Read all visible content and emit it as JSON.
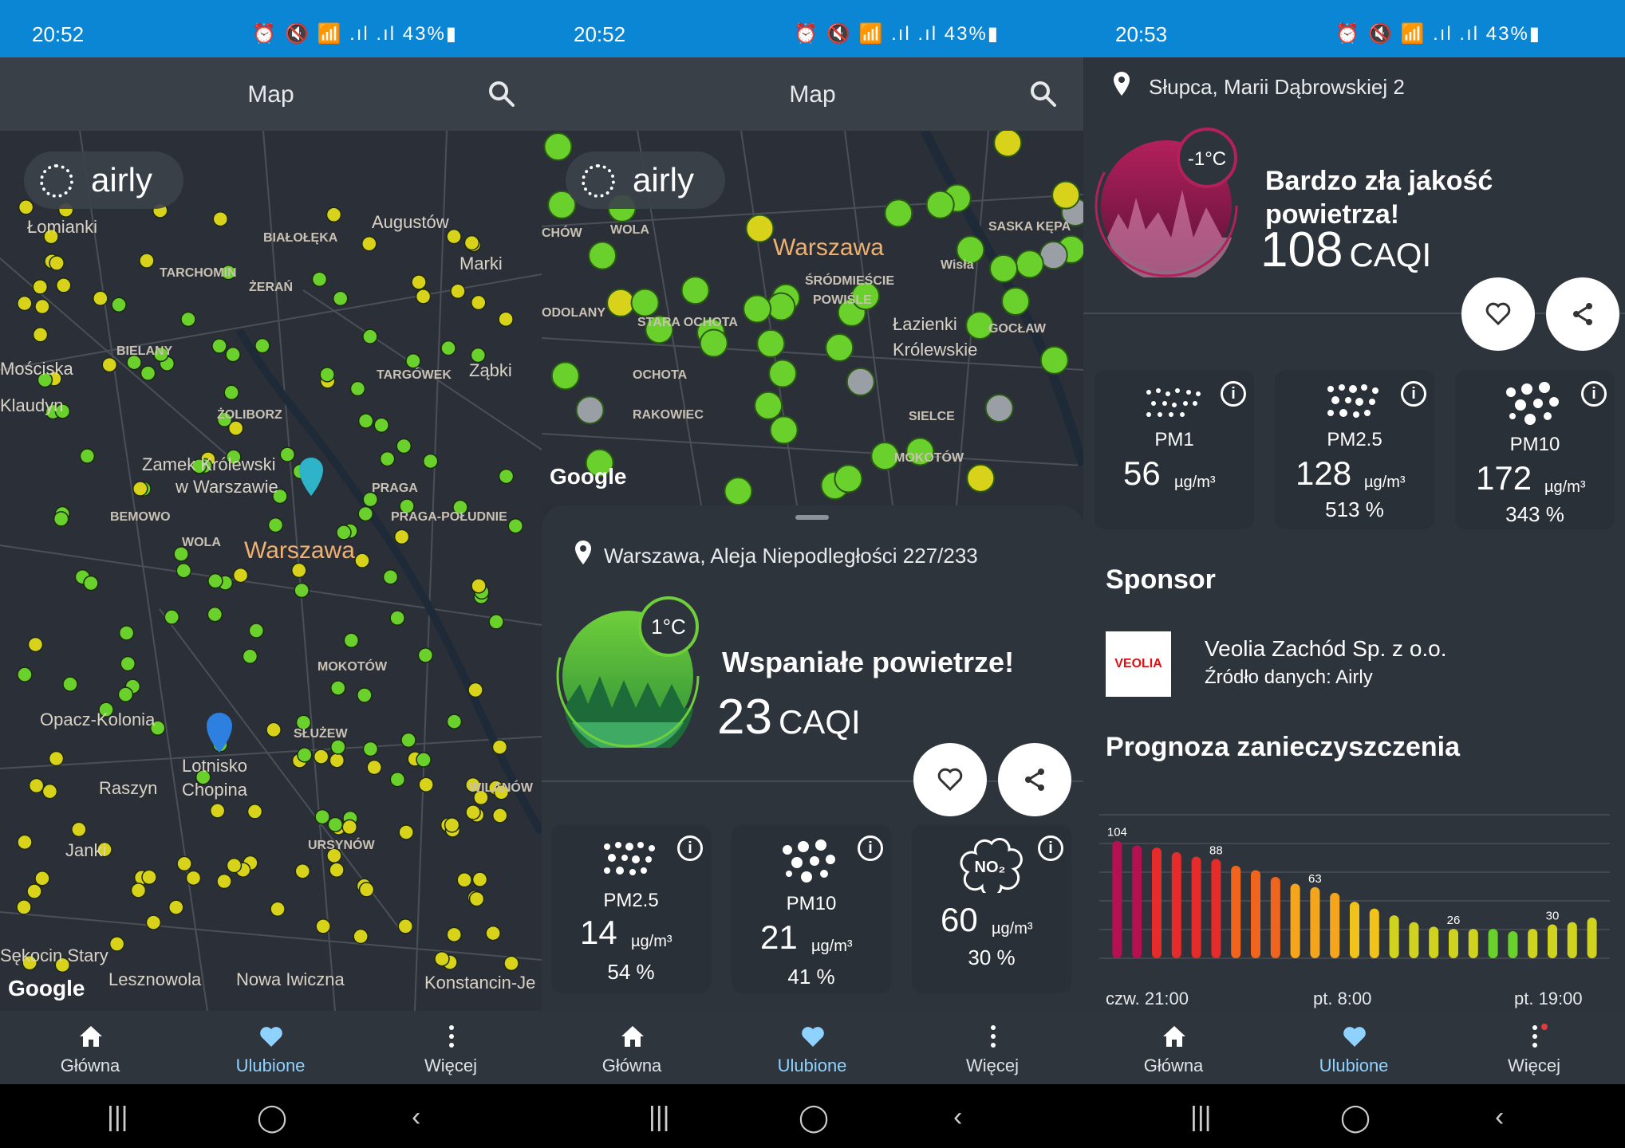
{
  "status": {
    "s1_time": "20:52",
    "s2_time": "20:52",
    "s3_time": "20:53",
    "icons_text": "⏰ 🔇 📶 .ıl .ıl 43%▮"
  },
  "appbar": {
    "title": "Map"
  },
  "map": {
    "brand": "airly",
    "google": "Google",
    "labels_s1": [
      {
        "t": "Łomianki",
        "c": "city"
      },
      {
        "t": "Augustów",
        "c": "city"
      },
      {
        "t": "Marki",
        "c": "city"
      },
      {
        "t": "BIAŁOŁĘKA",
        "c": "small"
      },
      {
        "t": "TARCHOMIN",
        "c": "small"
      },
      {
        "t": "ŻERAŃ",
        "c": "small"
      },
      {
        "t": "BIELANY",
        "c": "small"
      },
      {
        "t": "TARGÓWEK",
        "c": "small"
      },
      {
        "t": "Ząbki",
        "c": "city"
      },
      {
        "t": "Mościska",
        "c": "city"
      },
      {
        "t": "Klaudyn",
        "c": "city"
      },
      {
        "t": "ŻOLIBORZ",
        "c": "small"
      },
      {
        "t": "Zamek Królewski",
        "c": "city"
      },
      {
        "t": "w Warszawie",
        "c": "city"
      },
      {
        "t": "PRAGA",
        "c": "small"
      },
      {
        "t": "BEMOWO",
        "c": "small"
      },
      {
        "t": "PRAGA-POŁUDNIE",
        "c": "small"
      },
      {
        "t": "WOLA",
        "c": "small"
      },
      {
        "t": "Warszawa",
        "c": "big"
      },
      {
        "t": "MOKOTÓW",
        "c": "small"
      },
      {
        "t": "Opacz-Kolonia",
        "c": "city"
      },
      {
        "t": "SŁUŻEW",
        "c": "small"
      },
      {
        "t": "Lotnisko",
        "c": "city"
      },
      {
        "t": "Chopina",
        "c": "city"
      },
      {
        "t": "Raszyn",
        "c": "city"
      },
      {
        "t": "WILANÓW",
        "c": "small"
      },
      {
        "t": "Janki",
        "c": "city"
      },
      {
        "t": "URSYNÓW",
        "c": "small"
      },
      {
        "t": "Sękocin Stary",
        "c": "city"
      },
      {
        "t": "Lesznowola",
        "c": "city"
      },
      {
        "t": "Nowa Iwiczna",
        "c": "city"
      },
      {
        "t": "Konstancin-Je",
        "c": "city"
      }
    ],
    "labels_s2": [
      {
        "t": "Warszawa",
        "c": "big"
      },
      {
        "t": "CHÓW",
        "c": "small"
      },
      {
        "t": "WOLA",
        "c": "small"
      },
      {
        "t": "ŚRÓDMIEŚCIE",
        "c": "small"
      },
      {
        "t": "POWIŚLE",
        "c": "small"
      },
      {
        "t": "ODOLANY",
        "c": "small"
      },
      {
        "t": "STARA OCHOTA",
        "c": "small"
      },
      {
        "t": "Łazienki",
        "c": "city"
      },
      {
        "t": "Królewskie",
        "c": "city"
      },
      {
        "t": "OCHOTA",
        "c": "small"
      },
      {
        "t": "RAKOWIEC",
        "c": "small"
      },
      {
        "t": "SIELCE",
        "c": "small"
      },
      {
        "t": "MOKOTÓW",
        "c": "small"
      },
      {
        "t": "SASKA KĘPA",
        "c": "small"
      },
      {
        "t": "GOCŁAW",
        "c": "small"
      },
      {
        "t": "Wisła",
        "c": "small"
      }
    ]
  },
  "sheet2": {
    "address": "Warszawa, Aleja Niepodległości 227/233",
    "temp": "1°C",
    "mood": "Wspaniałe powietrze!",
    "caqi_value": "23",
    "caqi_unit": "CAQI",
    "cards": [
      {
        "name": "PM2.5",
        "value": "14",
        "unit": "µg/m³",
        "pct": "54 %"
      },
      {
        "name": "PM10",
        "value": "21",
        "unit": "µg/m³",
        "pct": "41 %"
      },
      {
        "name": "NO₂",
        "value": "60",
        "unit": "µg/m³",
        "pct": "30 %"
      }
    ]
  },
  "detail3": {
    "address": "Słupca, Marii Dąbrowskiej 2",
    "temp": "-1°C",
    "mood": "Bardzo zła jakość powietrza!",
    "caqi_value": "108",
    "caqi_unit": "CAQI",
    "cards": [
      {
        "name": "PM1",
        "value": "56",
        "unit": "µg/m³",
        "pct": ""
      },
      {
        "name": "PM2.5",
        "value": "128",
        "unit": "µg/m³",
        "pct": "513 %"
      },
      {
        "name": "PM10",
        "value": "172",
        "unit": "µg/m³",
        "pct": "343 %"
      }
    ],
    "sponsor_title": "Sponsor",
    "sponsor_logo": "VEOLIA",
    "sponsor_name": "Veolia Zachód Sp. z o.o.",
    "sponsor_source": "Źródło danych: Airly",
    "forecast_title": "Prognoza zanieczyszczenia",
    "forecast_x_labels": [
      "czw. 21:00",
      "pt. 8:00",
      "pt. 19:00"
    ]
  },
  "chart_data": {
    "type": "bar",
    "title": "Prognoza zanieczyszczenia",
    "categories": [
      "czw. 21:00",
      "",
      "",
      "",
      "",
      "",
      "",
      "",
      "",
      "",
      "",
      "pt. 8:00",
      "",
      "",
      "",
      "",
      "",
      "",
      "",
      "",
      "",
      "",
      "pt. 19:00"
    ],
    "values": [
      104,
      100,
      98,
      94,
      90,
      88,
      82,
      78,
      72,
      66,
      63,
      58,
      50,
      44,
      38,
      32,
      28,
      26,
      26,
      26,
      24,
      26,
      30,
      32,
      36
    ],
    "annotations": [
      {
        "index": 0,
        "text": "104"
      },
      {
        "index": 5,
        "text": "88"
      },
      {
        "index": 10,
        "text": "63"
      },
      {
        "index": 17,
        "text": "26"
      },
      {
        "index": 22,
        "text": "30"
      }
    ],
    "ylim": [
      0,
      120
    ],
    "grid": true
  },
  "nav": {
    "home": "Główna",
    "fav": "Ulubione",
    "more": "Więcej"
  }
}
